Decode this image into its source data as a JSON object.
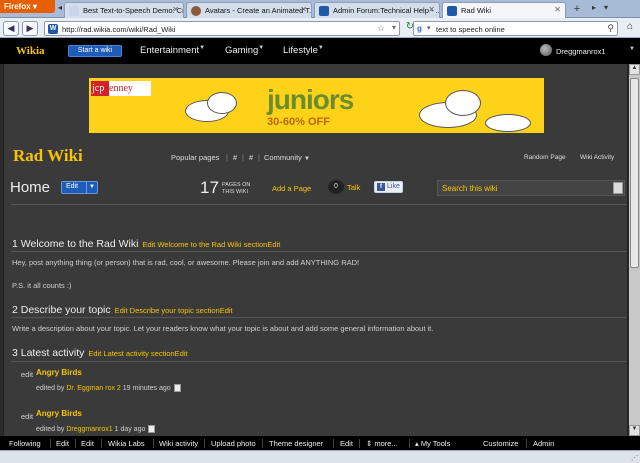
{
  "browser": {
    "menu_label": "Firefox",
    "tabs": [
      {
        "label": "Best Text-to-Speech Demo: Cre...",
        "icon_color": "#c8d6ea"
      },
      {
        "label": "Avatars - Create an Animated T...",
        "icon_color": "#8a5a3c"
      },
      {
        "label": "Admin Forum:Technical Help - ...",
        "icon_color": "#1e5aa8"
      },
      {
        "label": "Rad Wiki",
        "icon_color": "#1e5aa8"
      }
    ],
    "new_tab": "+",
    "url": "http://rad.wikia.com/wiki/Rad_Wiki",
    "favicon_letter": "W",
    "search_engine_icon": "google-icon",
    "search_text": "text to speech online"
  },
  "wikia": {
    "logo": "Wikia",
    "start_wiki": "Start a wiki",
    "nav": [
      "Entertainment",
      "Gaming",
      "Lifestyle"
    ],
    "user": "Dreggmanrox1"
  },
  "ad": {
    "brand_box": "jcp",
    "brand_rest": "enney",
    "headline": "juniors",
    "sale": "30-60% OFF",
    "colors": {
      "background": "#ffd21a",
      "headline": "#6a8d2e",
      "brand": "#d2232a"
    }
  },
  "wiki": {
    "name": "Rad Wiki",
    "nav": {
      "popular": "Popular pages",
      "hash1": "#",
      "hash2": "#",
      "community": "Community"
    },
    "tools": {
      "random": "Random Page",
      "activity": "Wiki Activity"
    }
  },
  "page": {
    "title": "Home",
    "edit": "Edit",
    "page_count": "17",
    "page_count_label_1": "PAGES ON",
    "page_count_label_2": "THIS WIKI",
    "add_page": "Add a Page",
    "talk_count": "0",
    "talk": "Talk",
    "like": "Like",
    "search_placeholder": "Search this wiki"
  },
  "sections": [
    {
      "heading": "1 Welcome to the Rad Wiki",
      "edit_link": "Edit Welcome to the Rad Wiki section",
      "edit_suffix": "Edit",
      "paragraphs": [
        "Hey, post anything thing (or person) that is rad, cool, or awesome. Please join and add ANYTHING RAD!",
        "P.S. it all counts :)"
      ]
    },
    {
      "heading": "2 Describe your topic",
      "edit_link": "Edit Describe your topic section",
      "edit_suffix": "Edit",
      "paragraphs": [
        "Write a description about your topic. Let your readers know what your topic is about and add some general information about it."
      ]
    },
    {
      "heading": "3 Latest activity",
      "edit_link": "Edit Latest activity section",
      "edit_suffix": "Edit",
      "paragraphs": []
    }
  ],
  "activity": [
    {
      "edit": "edit",
      "title": "Angry Birds",
      "prefix": "edited by ",
      "user": "Dr. Eggman rox 2",
      "time": " 19 minutes ago"
    },
    {
      "edit": "edit",
      "title": "Angry Birds",
      "prefix": "edited by ",
      "user": "Dreggmanrox1",
      "time": " 1 day ago"
    }
  ],
  "toolbar": [
    "Following",
    "Edit",
    "Edit",
    "Wikia Labs",
    "Wiki activity",
    "Upload photo",
    "Theme designer",
    "Edit",
    "more...",
    "My Tools",
    "Customize",
    "Admin"
  ],
  "toolbar_more_icon": "updown-arrow-icon",
  "toolbar_tools_icon": "tools-icon"
}
